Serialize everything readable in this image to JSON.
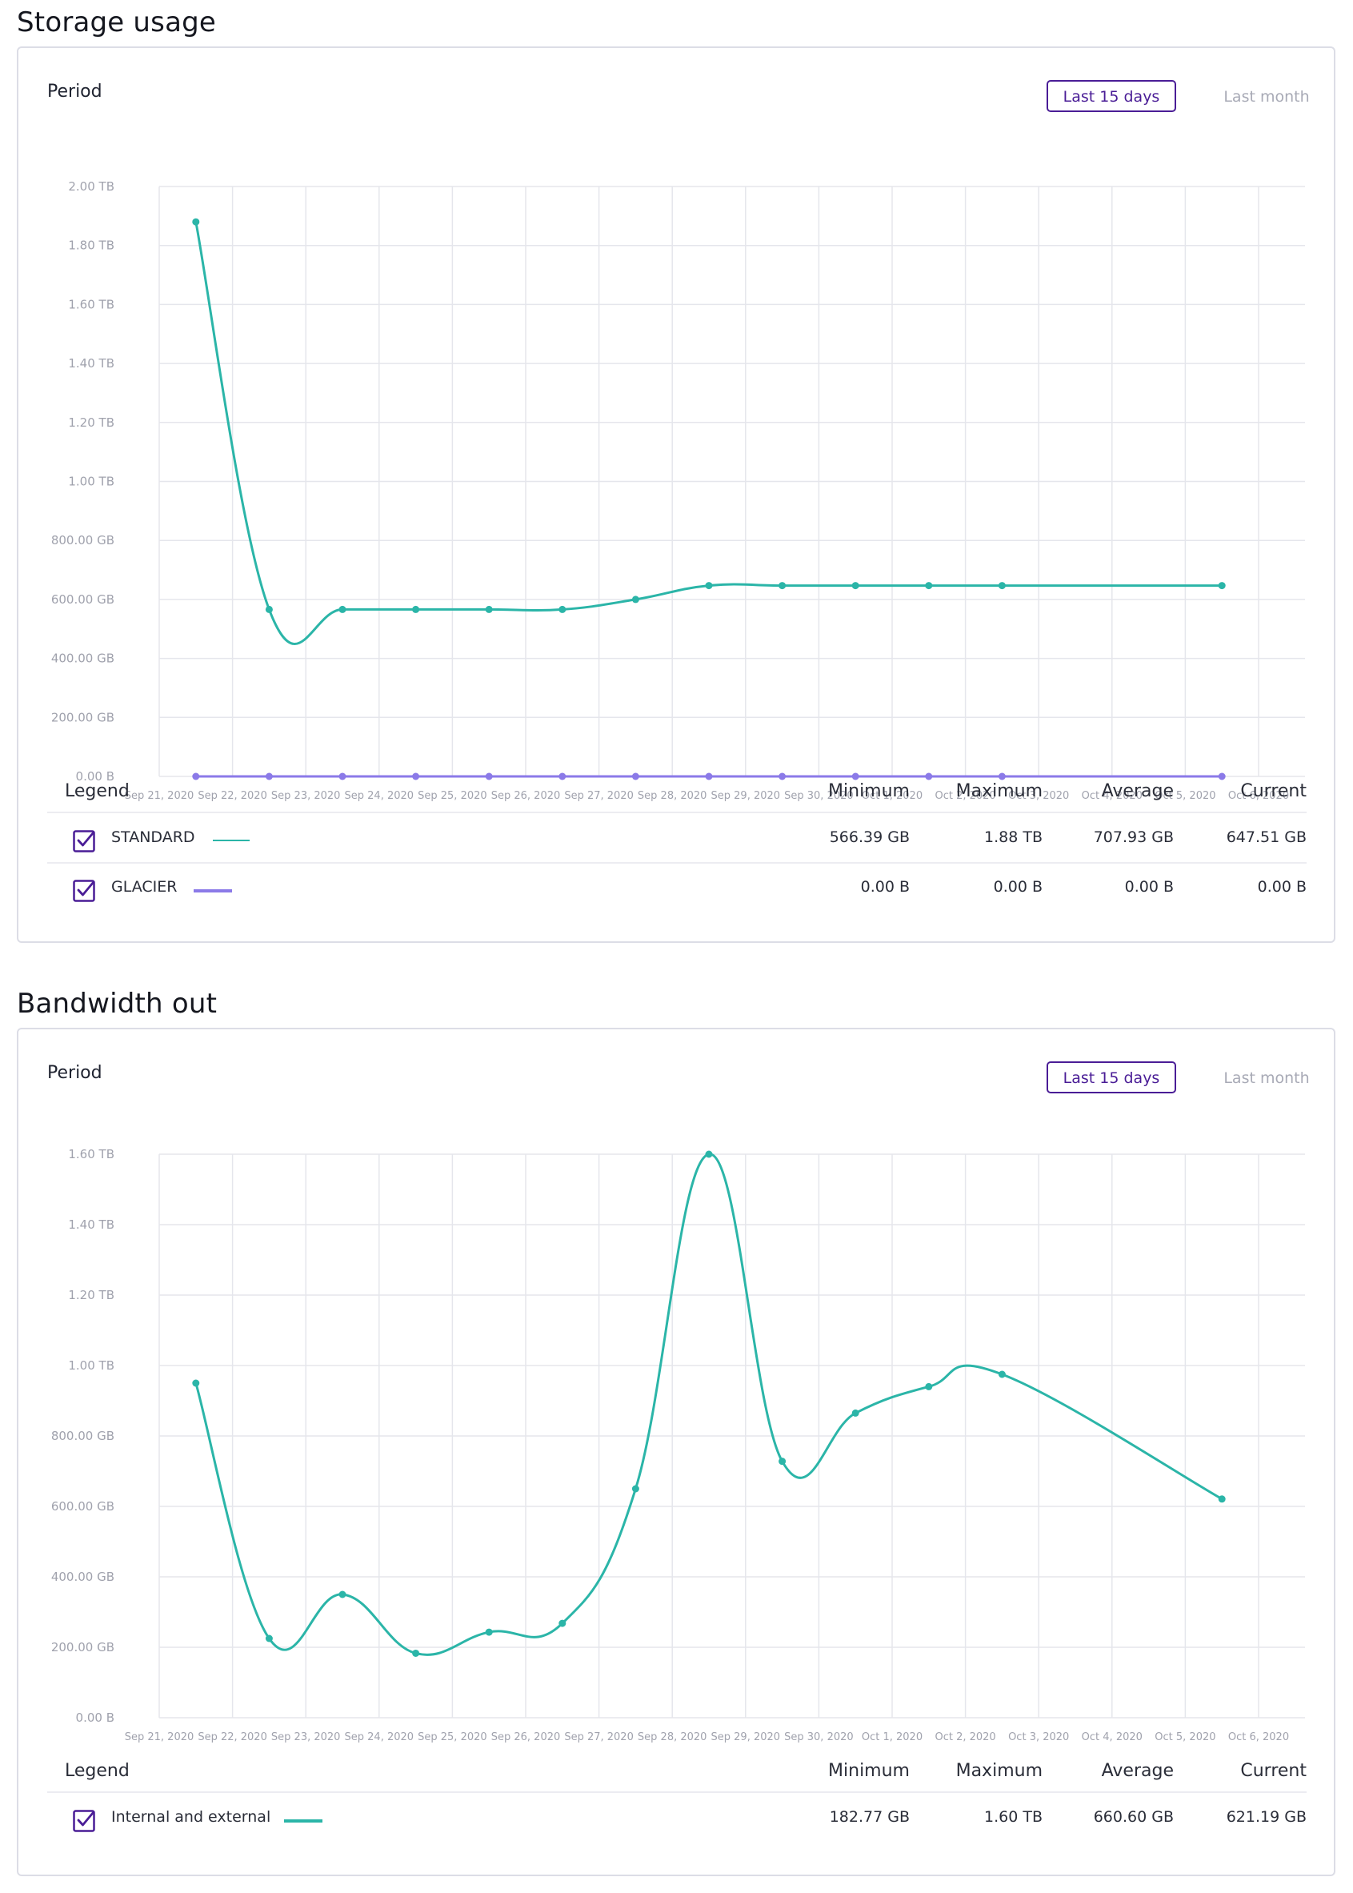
{
  "storage": {
    "title": "Storage usage",
    "period_label": "Period",
    "btn_active": "Last 15 days",
    "btn_inactive": "Last month",
    "legend_header": {
      "legend": "Legend",
      "min": "Minimum",
      "max": "Maximum",
      "avg": "Average",
      "cur": "Current"
    },
    "rows": [
      {
        "name": "STANDARD",
        "min": "566.39 GB",
        "max": "1.88 TB",
        "avg": "707.93 GB",
        "cur": "647.51 GB"
      },
      {
        "name": "GLACIER",
        "min": "0.00 B",
        "max": "0.00 B",
        "avg": "0.00 B",
        "cur": "0.00 B"
      }
    ]
  },
  "bandwidth": {
    "title": "Bandwidth out",
    "period_label": "Period",
    "btn_active": "Last 15 days",
    "btn_inactive": "Last month",
    "legend_header": {
      "legend": "Legend",
      "min": "Minimum",
      "max": "Maximum",
      "avg": "Average",
      "cur": "Current"
    },
    "rows": [
      {
        "name": "Internal and external",
        "min": "182.77 GB",
        "max": "1.60 TB",
        "avg": "660.60 GB",
        "cur": "621.19 GB"
      }
    ]
  },
  "colors": {
    "standard": "#2bb5a8",
    "glacier": "#8b7ae8",
    "accent": "#4a1d96"
  },
  "chart_data": [
    {
      "type": "line",
      "title": "Storage usage",
      "x_ticks": [
        "Sep 21, 2020",
        "Sep 22, 2020",
        "Sep 23, 2020",
        "Sep 24, 2020",
        "Sep 25, 2020",
        "Sep 26, 2020",
        "Sep 27, 2020",
        "Sep 28, 2020",
        "Sep 29, 2020",
        "Sep 30, 2020",
        "Oct 1, 2020",
        "Oct 2, 2020",
        "Oct 3, 2020",
        "Oct 4, 2020",
        "Oct 5, 2020",
        "Oct 6, 2020"
      ],
      "y_ticks": [
        "0.00 B",
        "200.00 GB",
        "400.00 GB",
        "600.00 GB",
        "800.00 GB",
        "1.00 TB",
        "1.20 TB",
        "1.40 TB",
        "1.60 TB",
        "1.80 TB",
        "2.00 TB"
      ],
      "ylim": [
        0,
        2000
      ],
      "y_unit": "GB",
      "x": [
        "Sep 21, 2020",
        "Sep 22, 2020",
        "Sep 23, 2020",
        "Sep 24, 2020",
        "Sep 25, 2020",
        "Sep 26, 2020",
        "Sep 27, 2020",
        "Sep 28, 2020",
        "Sep 29, 2020",
        "Sep 30, 2020",
        "Oct 1, 2020",
        "Oct 2, 2020",
        "Oct 5, 2020"
      ],
      "series": [
        {
          "name": "STANDARD",
          "color": "#2bb5a8",
          "values": [
            1880,
            566,
            566,
            566,
            566,
            566,
            600,
            647,
            647,
            647,
            647,
            647,
            647
          ]
        },
        {
          "name": "GLACIER",
          "color": "#8b7ae8",
          "values": [
            0,
            0,
            0,
            0,
            0,
            0,
            0,
            0,
            0,
            0,
            0,
            0,
            0
          ]
        }
      ],
      "grid": true,
      "legend": "bottom"
    },
    {
      "type": "line",
      "title": "Bandwidth out",
      "x_ticks": [
        "Sep 21, 2020",
        "Sep 22, 2020",
        "Sep 23, 2020",
        "Sep 24, 2020",
        "Sep 25, 2020",
        "Sep 26, 2020",
        "Sep 27, 2020",
        "Sep 28, 2020",
        "Sep 29, 2020",
        "Sep 30, 2020",
        "Oct 1, 2020",
        "Oct 2, 2020",
        "Oct 3, 2020",
        "Oct 4, 2020",
        "Oct 5, 2020",
        "Oct 6, 2020"
      ],
      "y_ticks": [
        "0.00 B",
        "200.00 GB",
        "400.00 GB",
        "600.00 GB",
        "800.00 GB",
        "1.00 TB",
        "1.20 TB",
        "1.40 TB",
        "1.60 TB"
      ],
      "ylim": [
        0,
        1600
      ],
      "y_unit": "GB",
      "x": [
        "Sep 21, 2020",
        "Sep 22, 2020",
        "Sep 23, 2020",
        "Sep 24, 2020",
        "Sep 25, 2020",
        "Sep 26, 2020",
        "Sep 27, 2020",
        "Sep 28, 2020",
        "Sep 29, 2020",
        "Sep 30, 2020",
        "Oct 1, 2020",
        "Oct 2, 2020",
        "Oct 5, 2020"
      ],
      "series": [
        {
          "name": "Internal and external",
          "color": "#2bb5a8",
          "values": [
            950,
            225,
            350,
            183,
            243,
            268,
            650,
            1600,
            728,
            865,
            940,
            975,
            621
          ]
        }
      ],
      "grid": true,
      "legend": "bottom"
    }
  ]
}
